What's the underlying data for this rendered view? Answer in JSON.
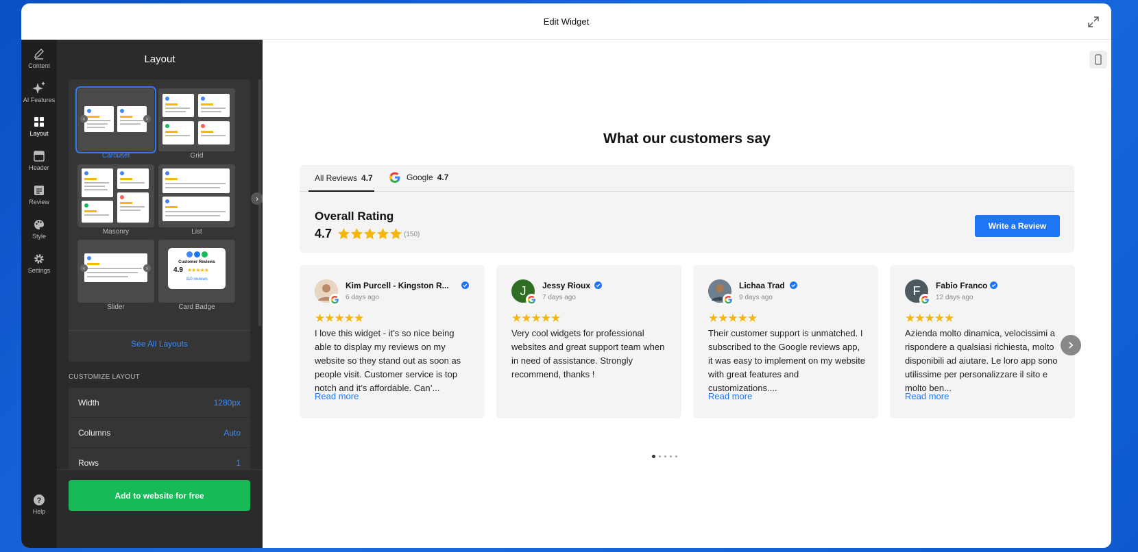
{
  "window": {
    "title": "Edit Widget"
  },
  "rail": {
    "items": [
      {
        "label": "Content",
        "icon": "pencil-icon"
      },
      {
        "label": "AI Features",
        "icon": "sparkle-icon"
      },
      {
        "label": "Layout",
        "icon": "layout-icon"
      },
      {
        "label": "Header",
        "icon": "header-icon"
      },
      {
        "label": "Review",
        "icon": "review-icon"
      },
      {
        "label": "Style",
        "icon": "palette-icon"
      },
      {
        "label": "Settings",
        "icon": "gear-icon"
      }
    ],
    "help": "Help",
    "active": "Layout"
  },
  "panel": {
    "title": "Layout",
    "layouts": [
      "Carousel",
      "Grid",
      "Masonry",
      "List",
      "Slider",
      "Card Badge"
    ],
    "selected_layout": "Carousel",
    "badge_preview": {
      "title": "Customer Reviews",
      "score": "4.9",
      "reviews": "110 reviews"
    },
    "see_all": "See All Layouts",
    "customize_heading": "CUSTOMIZE LAYOUT",
    "options": [
      {
        "label": "Width",
        "value": "1280px"
      },
      {
        "label": "Columns",
        "value": "Auto"
      },
      {
        "label": "Rows",
        "value": "1"
      }
    ],
    "add_button": "Add to website for free"
  },
  "preview": {
    "heading": "What our customers say",
    "tabs": [
      {
        "label": "All Reviews",
        "score": "4.7"
      },
      {
        "label": "Google",
        "score": "4.7"
      }
    ],
    "overall": {
      "title": "Overall Rating",
      "score": "4.7",
      "count": "(150)",
      "stars": 4.7
    },
    "write_button": "Write a Review",
    "reviews": [
      {
        "name": "Kim Purcell - Kingston R...",
        "date": "6 days ago",
        "text": "I love this widget - it’s so nice being able to display my reviews on my website so they stand out as soon as people visit. Customer service is top notch and it’s affordable. Can’...",
        "more": "Read more",
        "initial": "",
        "avatar_color": "#c9a98a"
      },
      {
        "name": "Jessy Rioux",
        "date": "7 days ago",
        "text": "Very cool widgets for professional websites and great support team when in need of assistance. Strongly recommend, thanks !",
        "more": "",
        "initial": "J",
        "avatar_color": "#2f6e23"
      },
      {
        "name": "Lichaa Trad",
        "date": "9 days ago",
        "text": "Their customer support is unmatched. I subscribed to the Google reviews app, it was easy to implement on my website with great features and customizations....",
        "more": "Read more",
        "initial": "",
        "avatar_color": "#8a6a4a"
      },
      {
        "name": "Fabio Franco",
        "date": "12 days ago",
        "text": "Azienda molto dinamica, velocissimi a rispondere a qualsiasi richiesta, molto disponibili ad aiutare. Le loro app sono utilissime per personalizzare il sito e molto ben...",
        "more": "Read more",
        "initial": "F",
        "avatar_color": "#4c5a60"
      }
    ],
    "pagination": {
      "pages": 5,
      "current": 1
    }
  },
  "colors": {
    "accent": "#1f76f4",
    "green": "#17b956",
    "star": "#f6b70d"
  }
}
